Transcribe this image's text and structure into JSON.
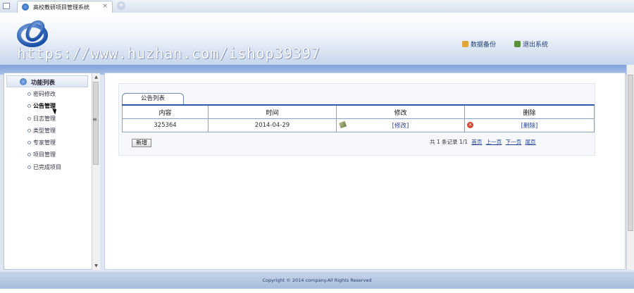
{
  "browser": {
    "tab_title": "高校教研项目管理系统",
    "close_glyph": "×",
    "new_tab_glyph": "+"
  },
  "header": {
    "watermark": "https://www.huzhan.com/ishop39397",
    "links": [
      {
        "label": "数据备份",
        "icon": "database-icon"
      },
      {
        "label": "退出系统",
        "icon": "exit-icon"
      }
    ]
  },
  "sidebar": {
    "title": "功能列表",
    "items": [
      {
        "label": "密码修改"
      },
      {
        "label": "公告管理"
      },
      {
        "label": "日志管理"
      },
      {
        "label": "类型管理"
      },
      {
        "label": "专家管理"
      },
      {
        "label": "项目管理"
      },
      {
        "label": "已完成项目"
      }
    ],
    "active_index": 1
  },
  "panel": {
    "tab_label": "公告列表",
    "columns": [
      "内容",
      "时间",
      "修改",
      "删除"
    ],
    "rows": [
      {
        "content": "325364",
        "time": "2014-04-29",
        "edit": "[修改]",
        "delete": "[删除]"
      }
    ],
    "add_button": "新增",
    "pager": {
      "summary": "共 1 条记录 1/1",
      "first": "首页",
      "prev": "上一页",
      "next": "下一页",
      "last": "尾页"
    }
  },
  "footer": {
    "copyright": "Copyright © 2014 company.All Rights Reserved"
  },
  "colors": {
    "accent": "#2a5aa8",
    "header_bar": "#7fa2d8",
    "link": "#1f3f9a"
  }
}
